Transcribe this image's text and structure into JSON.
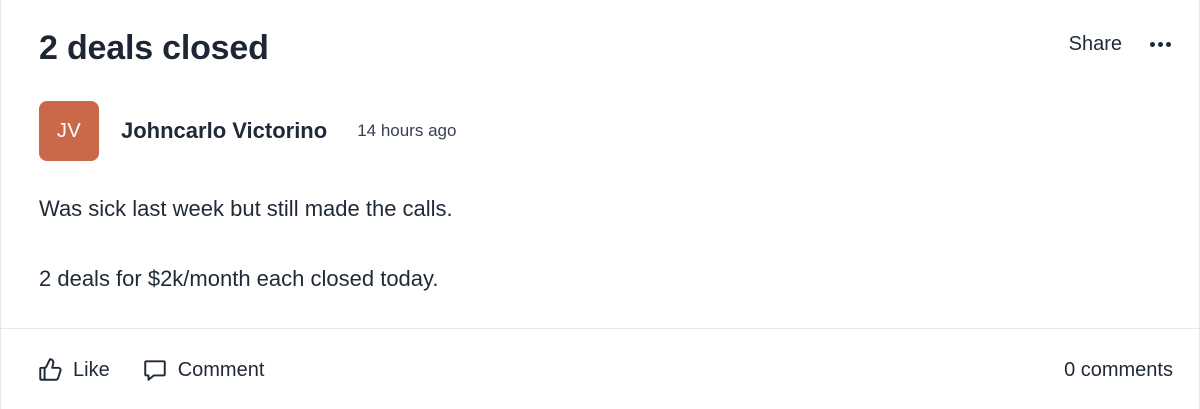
{
  "post": {
    "title": "2 deals closed",
    "share_label": "Share",
    "more_icon": "more-horizontal-icon"
  },
  "author": {
    "initials": "JV",
    "name": "Johncarlo Victorino",
    "timestamp": "14 hours ago",
    "avatar_color": "#c9694a"
  },
  "body": {
    "paragraphs": [
      "Was sick last week but still made the calls.",
      "2 deals for $2k/month each closed today."
    ]
  },
  "footer": {
    "like_label": "Like",
    "like_icon": "thumbs-up-icon",
    "comment_label": "Comment",
    "comment_icon": "speech-bubble-icon",
    "comment_count": "0 comments"
  }
}
